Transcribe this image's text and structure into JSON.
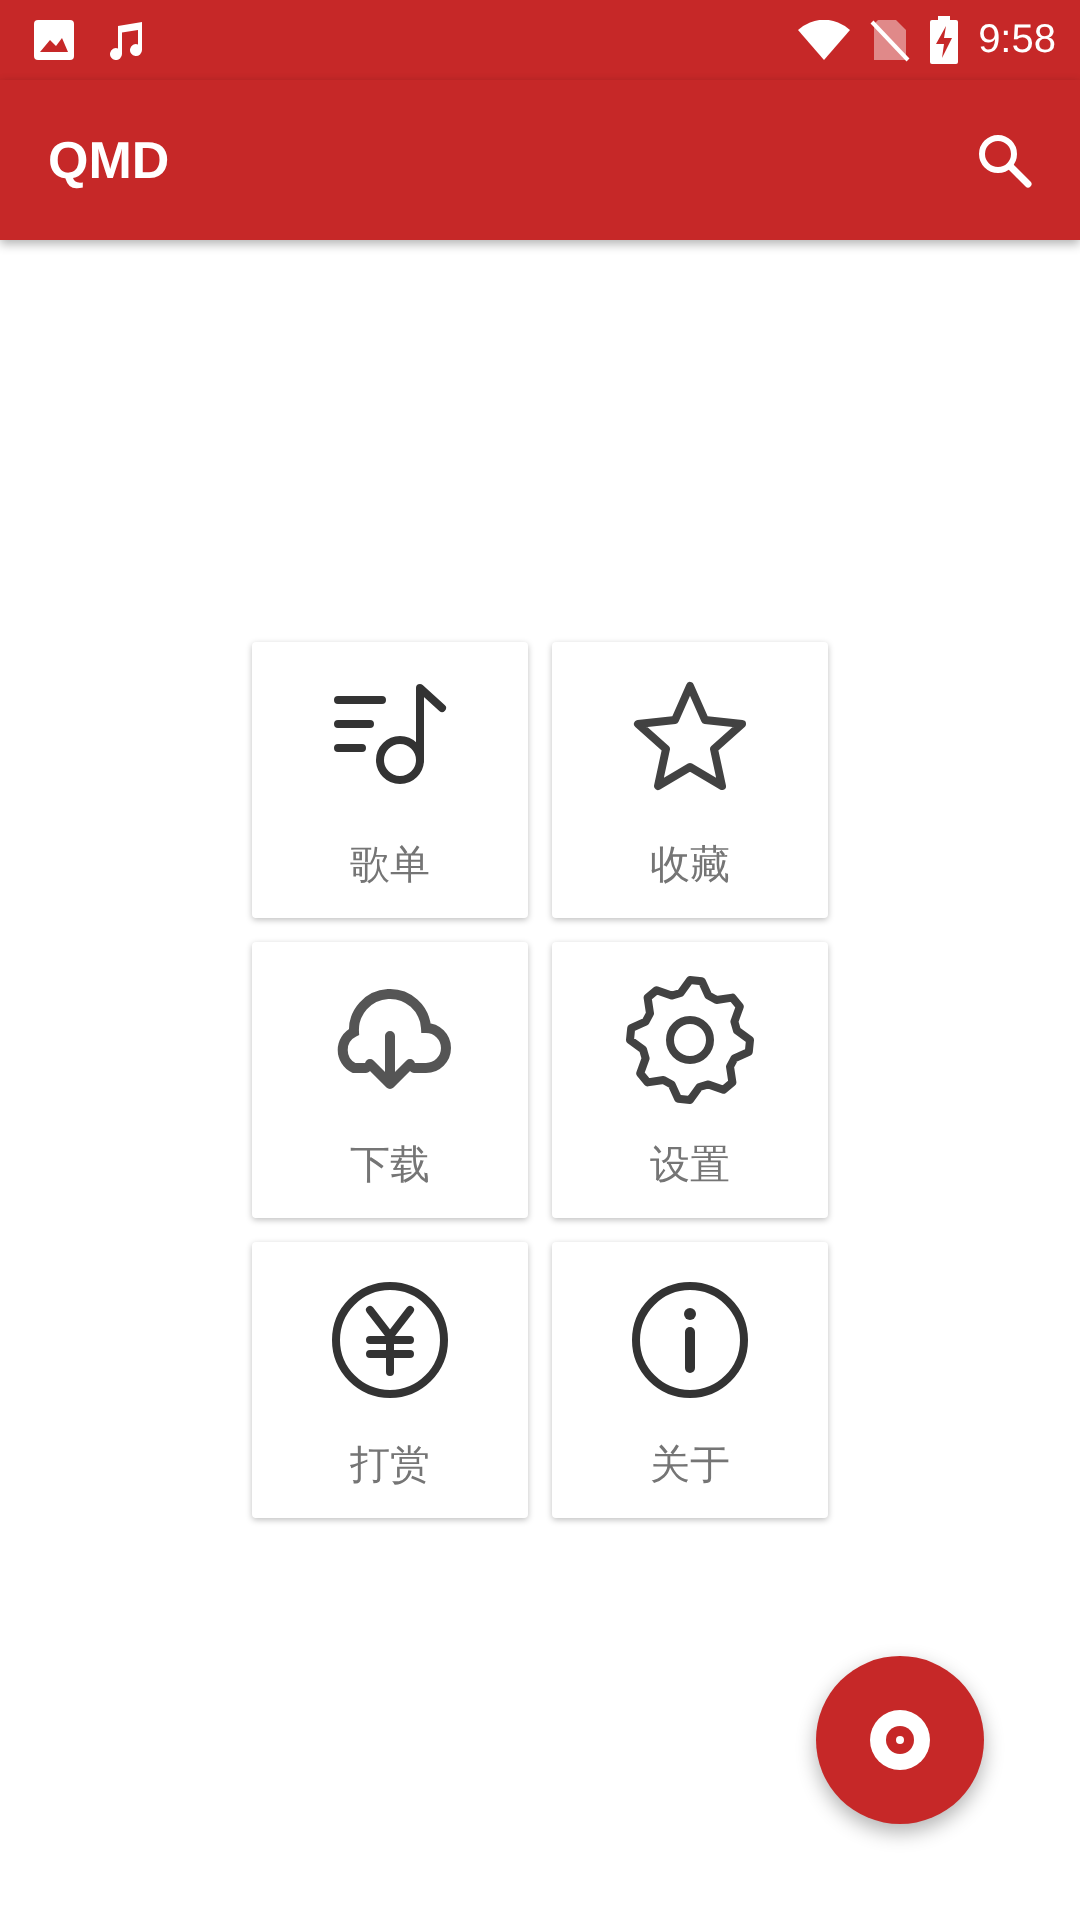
{
  "status_bar": {
    "time": "9:58"
  },
  "app_bar": {
    "title": "QMD"
  },
  "tiles": [
    {
      "kind": "playlist",
      "label": "歌单"
    },
    {
      "kind": "star",
      "label": "收藏"
    },
    {
      "kind": "download",
      "label": "下载"
    },
    {
      "kind": "settings",
      "label": "设置"
    },
    {
      "kind": "yen",
      "label": "打赏"
    },
    {
      "kind": "info",
      "label": "关于"
    }
  ]
}
